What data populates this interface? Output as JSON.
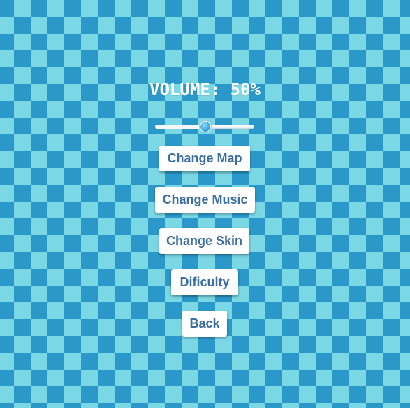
{
  "settings_menu": {
    "volume_label": "VOLUME: 50%",
    "volume_value": 0.5,
    "buttons": {
      "change_map": "Change Map",
      "change_music": "Change Music",
      "change_skin": "Change Skin",
      "difficulty": "Dificulty",
      "back": "Back"
    }
  },
  "colors": {
    "checker_dark": "#2a99c9",
    "checker_light": "#7ad7e4",
    "button_bg": "#ffffff",
    "button_text": "#3c6fa0",
    "title_text": "#ffffff"
  }
}
